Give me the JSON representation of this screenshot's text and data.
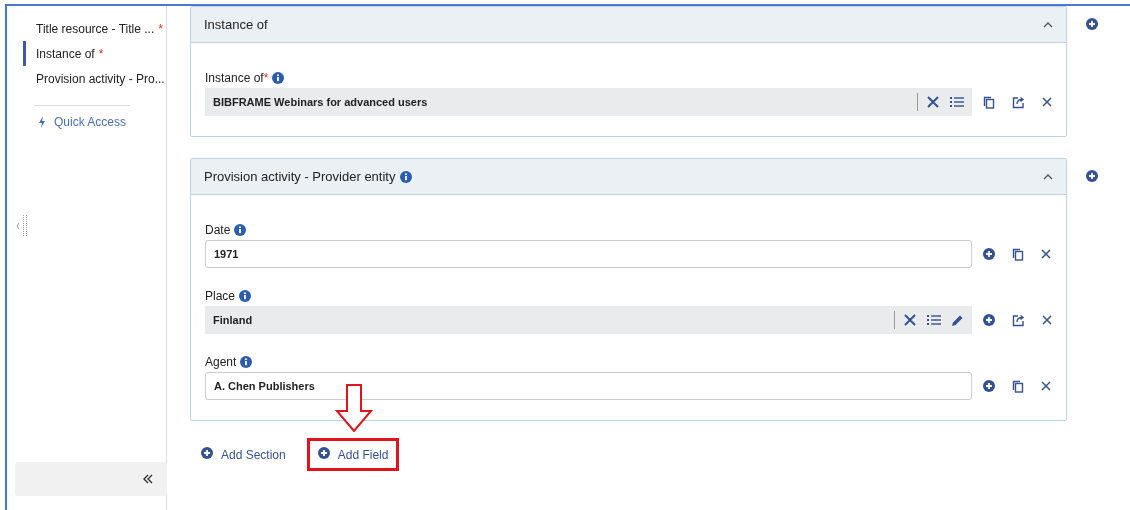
{
  "sidebar": {
    "items": [
      {
        "label": "Title resource - Title ...",
        "required_mark": "*",
        "selected": false
      },
      {
        "label": "Instance of",
        "required_mark": "*",
        "selected": true
      },
      {
        "label": "Provision activity - Pro...",
        "selected": false
      }
    ],
    "quick_access": "Quick Access"
  },
  "sections": [
    {
      "title": "Instance of",
      "info": false,
      "expanded": true,
      "fields": [
        {
          "label": "Instance of",
          "required_mark": "*",
          "kind": "lookup",
          "value": "BIBFRAME Webinars for advanced users",
          "editable": false,
          "addable": false,
          "copyable": true,
          "exportable": true
        }
      ]
    },
    {
      "title": "Provision activity - Provider entity",
      "info": true,
      "expanded": true,
      "fields": [
        {
          "label": "Date",
          "kind": "text",
          "value": "1971",
          "addable": true,
          "copyable": true,
          "exportable": false
        },
        {
          "label": "Place",
          "kind": "lookup",
          "value": "Finland",
          "editable": true,
          "addable": true,
          "copyable": false,
          "exportable": true
        },
        {
          "label": "Agent",
          "kind": "text",
          "value": "A. Chen Publishers",
          "addable": true,
          "copyable": true,
          "exportable": false
        }
      ]
    }
  ],
  "footer": {
    "buttons": [
      {
        "label": "Add Section",
        "highlighted": false
      },
      {
        "label": "Add Field",
        "highlighted": true
      }
    ]
  }
}
